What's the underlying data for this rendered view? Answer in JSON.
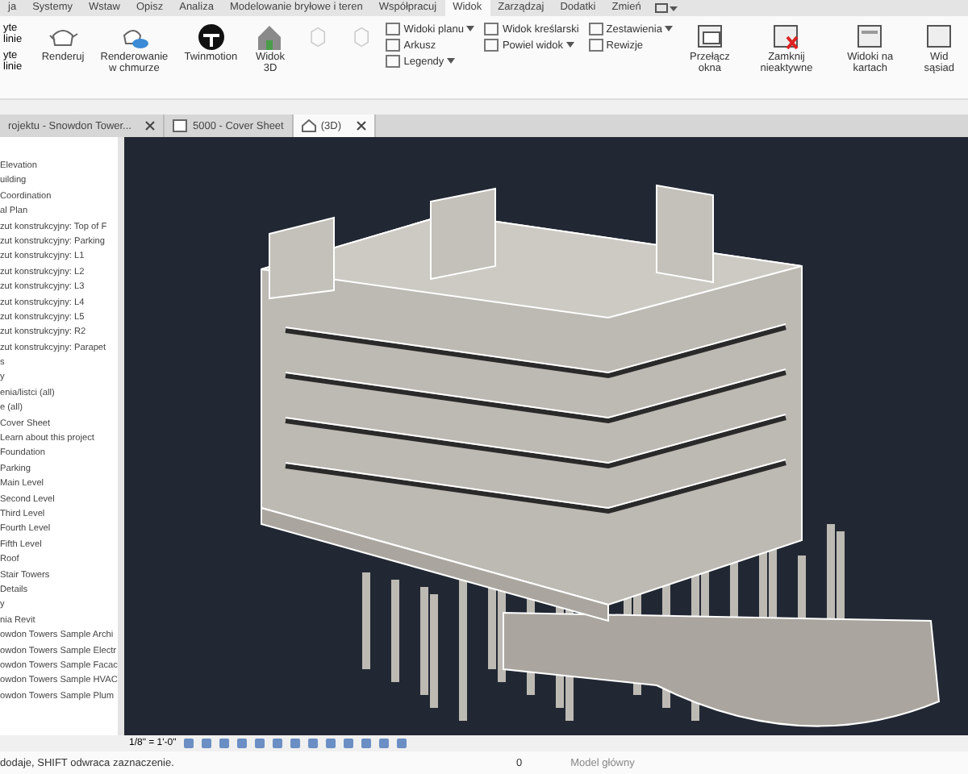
{
  "ribbon_tabs": [
    {
      "label": "ja",
      "selected": false
    },
    {
      "label": "Systemy",
      "selected": false
    },
    {
      "label": "Wstaw",
      "selected": false
    },
    {
      "label": "Opisz",
      "selected": false
    },
    {
      "label": "Analiza",
      "selected": false
    },
    {
      "label": "Modelowanie bryłowe i teren",
      "selected": false
    },
    {
      "label": "Współpracuj",
      "selected": false
    },
    {
      "label": "Widok",
      "selected": true
    },
    {
      "label": "Zarządzaj",
      "selected": false
    },
    {
      "label": "Dodatki",
      "selected": false
    },
    {
      "label": "Zmień",
      "selected": false
    }
  ],
  "ribbon_left": [
    "yte linie",
    "yte linie"
  ],
  "ribbon_large": [
    {
      "kind": "teapot",
      "label": "Renderuj"
    },
    {
      "kind": "cloud",
      "label": "Renderowanie w chmurze"
    },
    {
      "kind": "twinmotion",
      "label": "Twinmotion"
    },
    {
      "kind": "house",
      "label": "Widok 3D"
    }
  ],
  "ribbon_small": [
    {
      "kind": "dropdown",
      "label": "Widoki planu"
    },
    {
      "kind": "plain",
      "label": "Widok kreślarski"
    },
    {
      "kind": "dropdown",
      "label": "Zestawienia"
    },
    {
      "kind": "plain",
      "label": "Arkusz"
    },
    {
      "kind": "dropdown",
      "label": "Powiel widok"
    },
    {
      "kind": "plain",
      "label": "Rewizje"
    },
    {
      "kind": "dropdown",
      "label": "Legendy"
    }
  ],
  "ribbon_right": [
    {
      "kind": "switch",
      "label": "Przełącz okna"
    },
    {
      "kind": "close",
      "label": "Zamknij nieaktywne"
    },
    {
      "kind": "sheets",
      "label": "Widoki na kartach"
    },
    {
      "kind": "tile",
      "label": "Wid sąsiad"
    }
  ],
  "view_tabs": [
    {
      "kind": "browser",
      "label": "rojektu - Snowdon Tower...",
      "selected": false
    },
    {
      "kind": "sheet",
      "label": "5000 - Cover Sheet",
      "selected": false
    },
    {
      "kind": "view3d",
      "label": "(3D)",
      "selected": true
    }
  ],
  "browser_items": [
    "Elevation",
    "uilding",
    "Coordination",
    "al Plan",
    "zut konstrukcyjny: Top of F",
    "zut konstrukcyjny: Parking",
    "zut konstrukcyjny: L1",
    "zut konstrukcyjny: L2",
    "zut konstrukcyjny: L3",
    "zut konstrukcyjny: L4",
    "zut konstrukcyjny: L5",
    "zut konstrukcyjny: R2",
    "zut konstrukcyjny: Parapet",
    "s",
    "y",
    "enia/listci (all)",
    "e (all)",
    "Cover Sheet",
    "Learn about this project",
    "Foundation",
    "Parking",
    "Main Level",
    "Second Level",
    "Third Level",
    "Fourth Level",
    "Fifth Level",
    "Roof",
    "Stair Towers",
    "Details",
    "y",
    "nia Revit",
    "owdon Towers Sample Archi",
    "owdon Towers Sample Electr",
    "owdon Towers Sample Facac",
    "owdon Towers Sample HVAC",
    "owdon Towers Sample Plum"
  ],
  "view_control": {
    "scale": "1/8\" = 1'-0\""
  },
  "status_bar": {
    "message": "dodaje, SHIFT odwraca zaznaczenie.",
    "count": "0",
    "model": "Model główny"
  }
}
